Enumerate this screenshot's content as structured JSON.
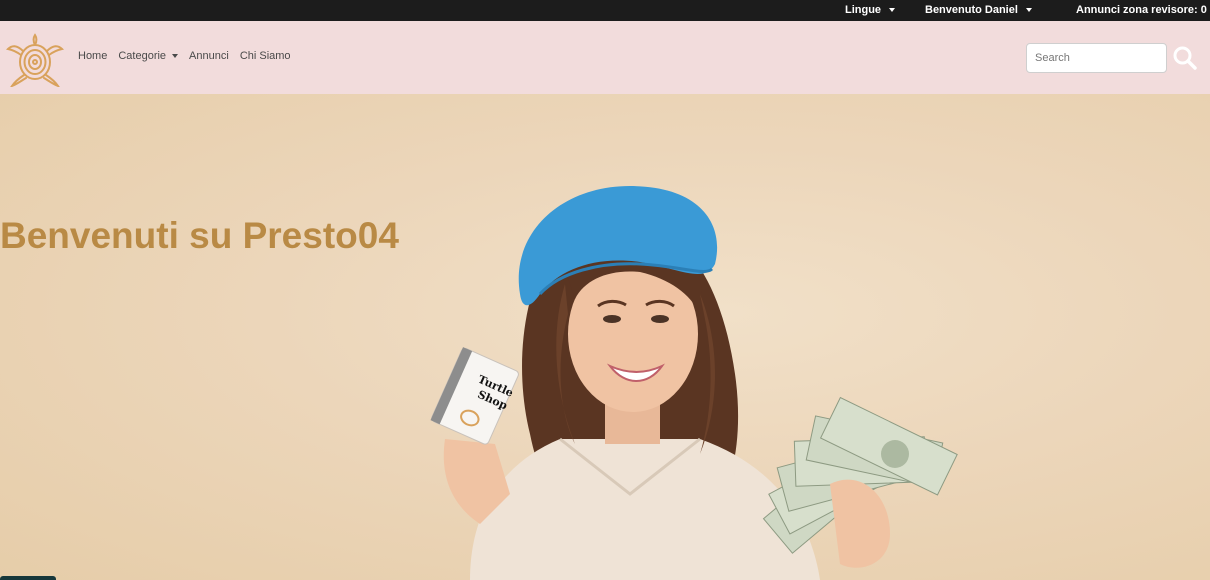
{
  "topbar": {
    "languages_label": "Lingue",
    "user_label": "Benvenuto Daniel",
    "revisor_label": "Annunci zona revisore: 0"
  },
  "nav": {
    "links": [
      "Home",
      "Categorie",
      "Annunci",
      "Chi Siamo"
    ],
    "search_placeholder": "Search"
  },
  "hero": {
    "title": "Benvenuti su Presto04",
    "card_text_line1": "Turtle",
    "card_text_line2": "Shop"
  },
  "colors": {
    "topbar": "#1c1c1c",
    "navbar": "#f2dcdc",
    "accent": "#b98a45",
    "hero_bg": "#ecd6ba"
  },
  "icons": {
    "logo": "turtle-logo-icon",
    "search": "search-icon",
    "dropdown": "chevron-down-icon"
  }
}
